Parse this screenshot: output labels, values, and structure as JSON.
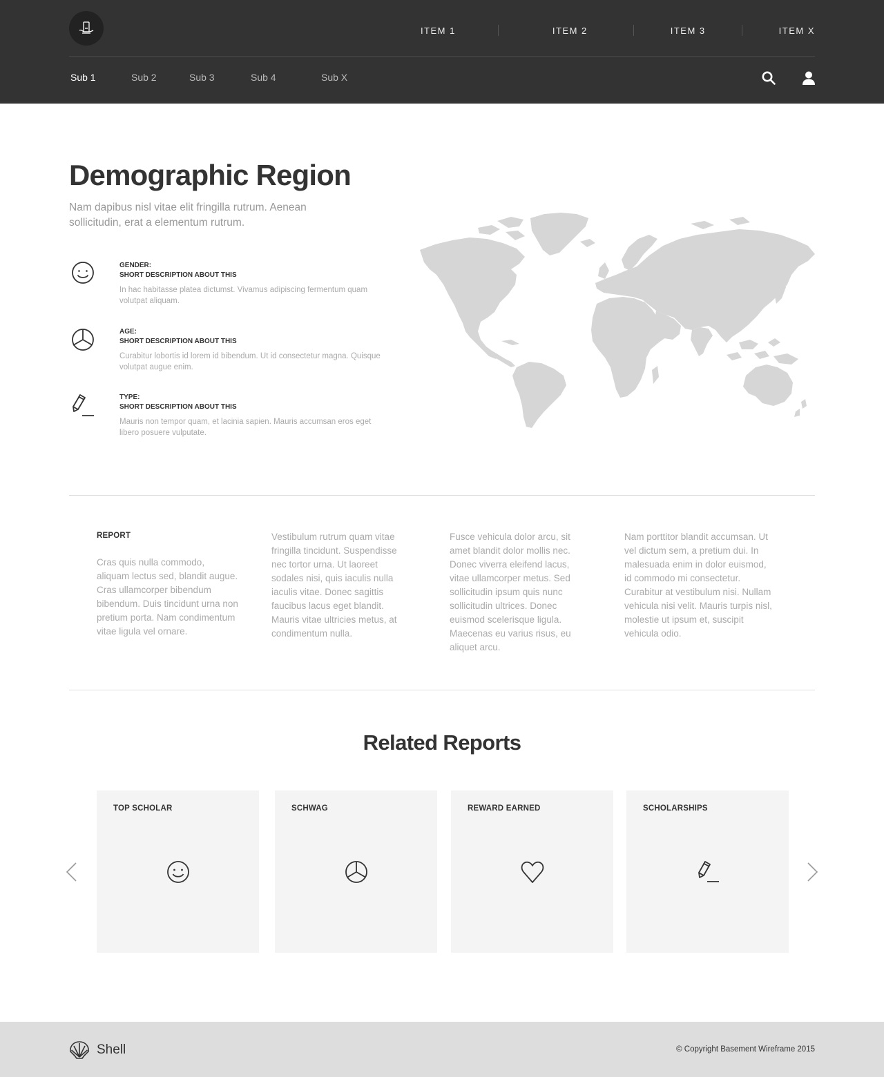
{
  "header": {
    "nav": [
      "ITEM 1",
      "ITEM 2",
      "ITEM 3",
      "ITEM X"
    ],
    "subnav": [
      "Sub 1",
      "Sub 2",
      "Sub 3",
      "Sub 4",
      "Sub X"
    ],
    "active_subnav": "Sub 1",
    "icons": {
      "logo": "phone-hand-icon",
      "search": "search-icon",
      "account": "user-icon"
    },
    "background": "#333333"
  },
  "hero": {
    "title": "Demographic Region",
    "intro": "Nam dapibus nisl vitae elit fringilla rutrum. Aenean sollicitudin, erat a elementum rutrum.",
    "features": [
      {
        "icon": "smiley-icon",
        "title": "GENDER:",
        "subtitle": "SHORT DESCRIPTION ABOUT THIS",
        "desc": "In hac habitasse platea dictumst. Vivamus adipiscing fermentum quam volutpat aliquam."
      },
      {
        "icon": "pie-chart-icon",
        "title": "AGE:",
        "subtitle": "SHORT DESCRIPTION ABOUT THIS",
        "desc": "Curabitur lobortis id lorem id bibendum. Ut id consectetur magna. Quisque volutpat augue enim."
      },
      {
        "icon": "pencil-icon",
        "title": "TYPE:",
        "subtitle": "SHORT DESCRIPTION ABOUT THIS",
        "desc": "Mauris non tempor quam, et lacinia sapien. Mauris accumsan eros eget libero posuere vulputate."
      }
    ],
    "map": {
      "icon": "world-map",
      "color": "#d6d6d6"
    }
  },
  "report": {
    "heading": "REPORT",
    "columns": [
      "Cras quis nulla commodo, aliquam lectus sed, blandit augue. Cras ullamcorper bibendum bibendum. Duis tincidunt urna non pretium porta. Nam condimentum vitae ligula vel ornare.",
      "Vestibulum rutrum quam vitae fringilla tincidunt. Suspendisse nec tortor urna. Ut laoreet sodales nisi, quis iaculis nulla iaculis vitae. Donec sagittis faucibus lacus eget blandit. Mauris vitae ultricies metus, at condimentum nulla.",
      "Fusce vehicula dolor arcu, sit amet blandit dolor mollis nec. Donec viverra eleifend lacus, vitae ullamcorper metus. Sed sollicitudin ipsum quis nunc sollicitudin ultrices. Donec euismod scelerisque ligula. Maecenas eu varius risus, eu aliquet arcu.",
      "Nam porttitor blandit accumsan. Ut vel dictum sem, a pretium dui. In malesuada enim in dolor euismod, id commodo mi consectetur. Curabitur at vestibulum nisi. Nullam vehicula nisi velit. Mauris turpis nisl, molestie ut ipsum et, suscipit vehicula odio."
    ]
  },
  "related": {
    "title": "Related Reports",
    "cards": [
      {
        "title": "TOP SCHOLAR",
        "icon": "smiley-icon"
      },
      {
        "title": "SCHWAG",
        "icon": "pie-chart-icon"
      },
      {
        "title": "REWARD EARNED",
        "icon": "heart-icon"
      },
      {
        "title": "SCHOLARSHIPS",
        "icon": "pencil-icon"
      }
    ],
    "prev_icon": "chevron-left-icon",
    "next_icon": "chevron-right-icon",
    "card_bg": "#f4f4f4"
  },
  "footer": {
    "brand": "Shell",
    "brand_icon": "shell-logo-icon",
    "copyright": "© Copyright Basement Wireframe  2015",
    "background": "#dddddd"
  }
}
